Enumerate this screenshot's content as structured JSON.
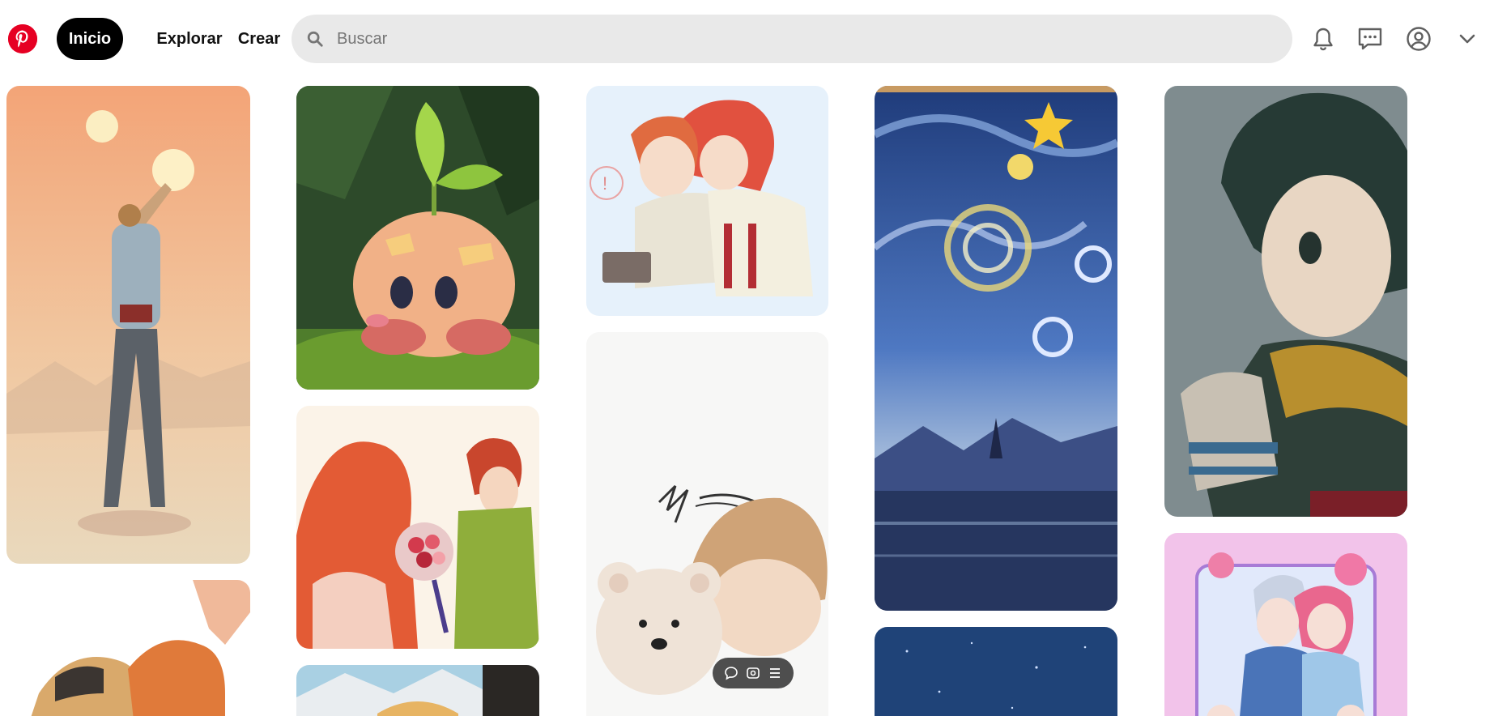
{
  "header": {
    "logo_icon": "pinterest-logo-icon",
    "brand_color": "#e60023",
    "nav": {
      "home_label": "Inicio",
      "explore_label": "Explorar",
      "create_label": "Crear"
    },
    "search": {
      "placeholder": "Buscar",
      "value": "",
      "icon": "search-icon"
    },
    "icons": [
      "bell-icon",
      "chat-icon",
      "account-icon",
      "chevron-down-icon"
    ]
  },
  "pins": [
    {
      "subject": "man reaching toward two suns",
      "column": 1
    },
    {
      "subject": "anime group hug",
      "column": 1
    },
    {
      "subject": "kirby with sprout",
      "column": 2
    },
    {
      "subject": "girl and boy with bouquet",
      "column": 2
    },
    {
      "subject": "mountain landscape",
      "column": 2
    },
    {
      "subject": "red-haired couple embrace",
      "column": 3
    },
    {
      "subject": "boy with teddy bear",
      "column": 3
    },
    {
      "subject": "starry night city",
      "column": 4
    },
    {
      "subject": "night sky",
      "column": 4
    },
    {
      "subject": "green-haired hero with scarf",
      "column": 5
    },
    {
      "subject": "pastel anime couple",
      "column": 5
    }
  ],
  "pin_toolbar": {
    "icons": [
      "comment-icon",
      "view-icon",
      "menu-icon"
    ]
  },
  "colors": {
    "nav_active_bg": "#000000",
    "search_bg": "#e9e9e9"
  }
}
